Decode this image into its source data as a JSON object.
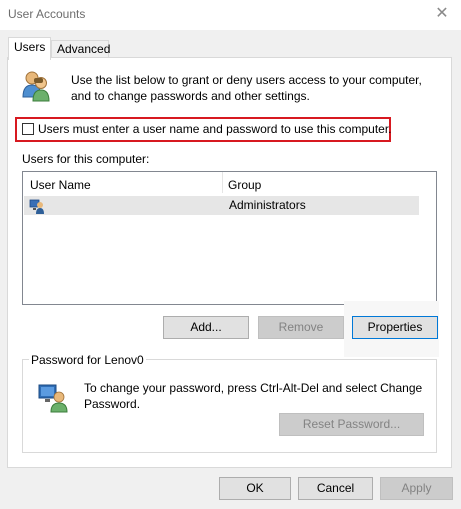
{
  "window": {
    "title": "User Accounts",
    "close_glyph": "✕"
  },
  "tabs": [
    {
      "label": "Users",
      "active": true
    },
    {
      "label": "Advanced",
      "active": false
    }
  ],
  "intro_text": "Use the list below to grant or deny users access to your computer, and to change passwords and other settings.",
  "require_login": {
    "label": "Users must enter a user name and password to use this computer.",
    "checked": false
  },
  "users_section": {
    "label": "Users for this computer:",
    "columns": [
      "User Name",
      "Group"
    ],
    "rows": [
      {
        "user_name": "",
        "group": "Administrators"
      }
    ]
  },
  "user_buttons": {
    "add": "Add...",
    "remove": "Remove",
    "properties": "Properties"
  },
  "password_section": {
    "title": "Password for Lenov0",
    "text": "To change your password, press Ctrl-Alt-Del and select Change Password.",
    "reset_button": "Reset Password..."
  },
  "dialog_buttons": {
    "ok": "OK",
    "cancel": "Cancel",
    "apply": "Apply"
  },
  "colors": {
    "highlight_border": "#d71920",
    "panel": "#ffffff",
    "chrome": "#f0f0f0"
  },
  "icons": {
    "users": "users-icon",
    "user_row": "user-row-icon",
    "password": "password-user-icon"
  }
}
